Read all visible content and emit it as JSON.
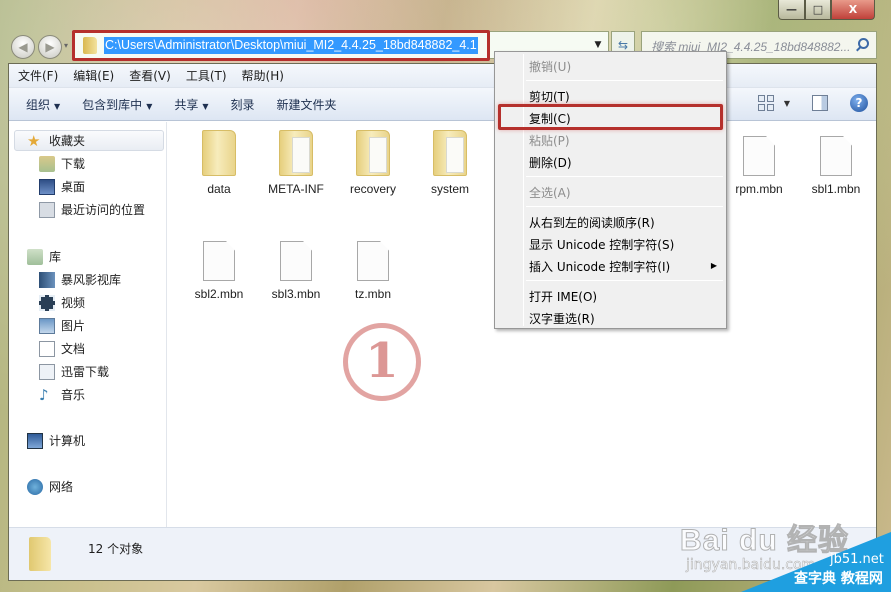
{
  "window": {
    "controls": {
      "minimize": "—",
      "maximize": "□",
      "close": "X"
    }
  },
  "address_bar": {
    "path": "C:\\Users\\Administrator\\Desktop\\miui_MI2_4.4.25_18bd848882_4.1",
    "icon": "folder-icon"
  },
  "search": {
    "placeholder": "搜索 miui_MI2_4.4.25_18bd848882..."
  },
  "menubar": {
    "items": [
      "文件(F)",
      "编辑(E)",
      "查看(V)",
      "工具(T)",
      "帮助(H)"
    ]
  },
  "commandbar": {
    "items": [
      {
        "label": "组织",
        "dropdown": true
      },
      {
        "label": "包含到库中",
        "dropdown": true
      },
      {
        "label": "共享",
        "dropdown": true
      },
      {
        "label": "刻录",
        "dropdown": false
      },
      {
        "label": "新建文件夹",
        "dropdown": false
      }
    ],
    "help_glyph": "?"
  },
  "sidebar": {
    "favorites": {
      "label": "收藏夹",
      "items": [
        "下载",
        "桌面",
        "最近访问的位置"
      ]
    },
    "libraries": {
      "label": "库",
      "items": [
        "暴风影视库",
        "视频",
        "图片",
        "文档",
        "迅雷下载",
        "音乐"
      ]
    },
    "computer": {
      "label": "计算机"
    },
    "network": {
      "label": "网络"
    }
  },
  "files": [
    {
      "name": "data",
      "type": "folder"
    },
    {
      "name": "META-INF",
      "type": "folder"
    },
    {
      "name": "recovery",
      "type": "folder"
    },
    {
      "name": "system",
      "type": "folder"
    },
    {
      "name": "rpm.mbn",
      "type": "file"
    },
    {
      "name": "sbl1.mbn",
      "type": "file"
    },
    {
      "name": "sbl2.mbn",
      "type": "file"
    },
    {
      "name": "sbl3.mbn",
      "type": "file"
    },
    {
      "name": "tz.mbn",
      "type": "file"
    }
  ],
  "status": {
    "count": "12 个对象"
  },
  "context_menu": {
    "items": [
      {
        "label": "撤销(U)",
        "enabled": false
      },
      {
        "label": "剪切(T)",
        "enabled": true
      },
      {
        "label": "复制(C)",
        "enabled": true,
        "highlighted": true
      },
      {
        "label": "粘贴(P)",
        "enabled": false
      },
      {
        "label": "删除(D)",
        "enabled": true
      },
      {
        "label": "全选(A)",
        "enabled": false
      },
      {
        "label": "从右到左的阅读顺序(R)",
        "enabled": true
      },
      {
        "label": "显示 Unicode 控制字符(S)",
        "enabled": true
      },
      {
        "label": "插入 Unicode 控制字符(I)",
        "enabled": true,
        "submenu": true
      },
      {
        "label": "打开 IME(O)",
        "enabled": true
      },
      {
        "label": "汉字重选(R)",
        "enabled": true
      }
    ]
  },
  "annotation": {
    "step": "1",
    "highlight_color": "#b5302c"
  },
  "watermark": {
    "brand": "Bai du 经验",
    "sub": "jingyan.baidu.com",
    "site": "jb51.net",
    "tutorial": "查字典 教程网"
  }
}
